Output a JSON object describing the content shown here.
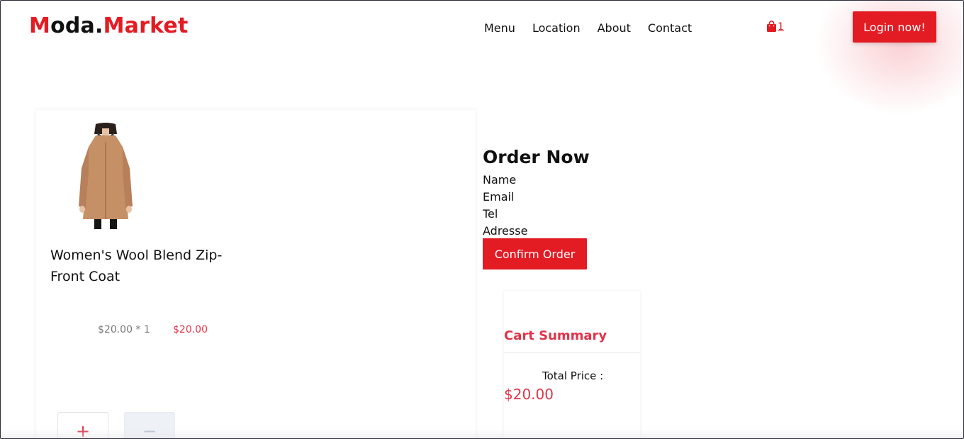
{
  "header": {
    "logo_m": "M",
    "logo_oda": "oda.",
    "logo_market": "Market",
    "nav": [
      "Menu",
      "Location",
      "About",
      "Contact"
    ],
    "cart_icon": "shopping-bag-icon",
    "cart_count": "1",
    "login_label": "Login now!"
  },
  "product": {
    "title": "Women's Wool Blend Zip-Front Coat",
    "unit_price": "$20.00 * 1",
    "line_total": "$20.00",
    "plus_label": "+",
    "minus_label": "−"
  },
  "order": {
    "heading": "Order Now",
    "fields": [
      "Name",
      "Email",
      "Tel",
      "Adresse"
    ],
    "confirm_label": "Confirm Order"
  },
  "summary": {
    "title": "Cart Summary",
    "total_label": "Total Price :",
    "total_value": "$20.00"
  },
  "colors": {
    "brand_red": "#e31b23",
    "price_red": "#e0344a"
  }
}
